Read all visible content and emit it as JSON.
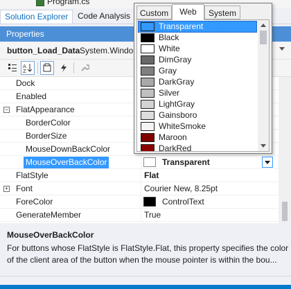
{
  "file_row": {
    "label": "Program.cs"
  },
  "pane_tabs": [
    "Solution Explorer",
    "Code Analysis"
  ],
  "properties": {
    "title": "Properties",
    "object_name": "button_Load_Data",
    "object_type": "System.Windo"
  },
  "toolbar": {
    "categorized_icon": "categorized-icon",
    "alphabetical_icon": "alphabetical-icon",
    "properties_icon": "properties-icon",
    "events_icon": "events-icon",
    "property_pages_icon": "wrench-icon"
  },
  "grid": {
    "rows": [
      {
        "name": "Dock",
        "value": "",
        "indent": 1
      },
      {
        "name": "Enabled",
        "value": "",
        "indent": 1
      },
      {
        "name": "FlatAppearance",
        "value": "",
        "indent": 1,
        "expander": "⊟"
      },
      {
        "name": "BorderColor",
        "value": "",
        "indent": 2
      },
      {
        "name": "BorderSize",
        "value": "",
        "indent": 2
      },
      {
        "name": "MouseDownBackColor",
        "value": "",
        "indent": 2
      },
      {
        "name": "MouseOverBackColor",
        "value": "Transparent",
        "indent": 2,
        "selected": true
      },
      {
        "name": "FlatStyle",
        "value": "Flat",
        "indent": 1,
        "bold": true
      },
      {
        "name": "Font",
        "value": "Courier New, 8.25pt",
        "indent": 1,
        "expander": "⊞"
      },
      {
        "name": "ForeColor",
        "value": "ControlText",
        "indent": 1,
        "swatch": "#000000"
      },
      {
        "name": "GenerateMember",
        "value": "True",
        "indent": 1
      }
    ]
  },
  "description": {
    "title": "MouseOverBackColor",
    "lines": [
      "For buttons whose FlatStyle is FlatStyle.Flat, this property specifies the color",
      "of the client area of the button when the mouse pointer is within the bou..."
    ]
  },
  "color_popup": {
    "tabs": [
      "Custom",
      "Web",
      "System"
    ],
    "active_tab": "Web",
    "colors": [
      {
        "name": "Transparent",
        "hex": "#ffffff",
        "selected": true
      },
      {
        "name": "Black",
        "hex": "#000000"
      },
      {
        "name": "White",
        "hex": "#ffffff"
      },
      {
        "name": "DimGray",
        "hex": "#696969"
      },
      {
        "name": "Gray",
        "hex": "#808080"
      },
      {
        "name": "DarkGray",
        "hex": "#a9a9a9"
      },
      {
        "name": "Silver",
        "hex": "#c0c0c0"
      },
      {
        "name": "LightGray",
        "hex": "#d3d3d3"
      },
      {
        "name": "Gainsboro",
        "hex": "#dcdcdc"
      },
      {
        "name": "WhiteSmoke",
        "hex": "#f5f5f5"
      },
      {
        "name": "Maroon",
        "hex": "#800000"
      },
      {
        "name": "DarkRed",
        "hex": "#8b0000"
      }
    ]
  },
  "colors": {
    "accent": "#3399ff",
    "title_bar": "#4d8fd6",
    "status_bar": "#007acc"
  }
}
